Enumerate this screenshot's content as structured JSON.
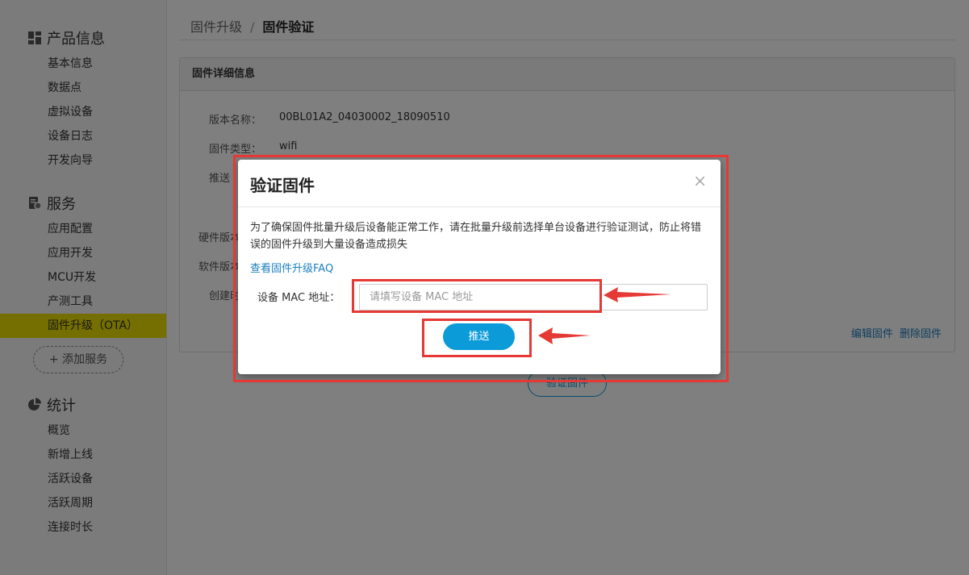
{
  "sidebar": {
    "groups": [
      {
        "title": "产品信息",
        "icon": "dashboard-icon",
        "items": [
          "基本信息",
          "数据点",
          "虚拟设备",
          "设备日志",
          "开发向导"
        ]
      },
      {
        "title": "服务",
        "icon": "service-icon",
        "items": [
          "应用配置",
          "应用开发",
          "MCU开发",
          "产测工具",
          "固件升级（OTA）"
        ]
      },
      {
        "title": "统计",
        "icon": "pie-chart-icon",
        "items": [
          "概览",
          "新增上线",
          "活跃设备",
          "活跃周期",
          "连接时长"
        ]
      }
    ],
    "add_service": "+ 添加服务",
    "active_item": "固件升级（OTA）",
    "active_color": "#e8de00"
  },
  "breadcrumb": {
    "parent": "固件升级",
    "separator": "/",
    "current": "固件验证"
  },
  "panel": {
    "title": "固件详细信息",
    "fields": [
      {
        "label": "版本名称：",
        "value": "00BL01A2_04030002_18090510"
      },
      {
        "label": "固件类型：",
        "value": "wifi"
      },
      {
        "label": "推送",
        "value": ""
      },
      {
        "label": "硬件版本",
        "value": ""
      },
      {
        "label": "软件版本",
        "value": ""
      },
      {
        "label": "创建时",
        "value": ""
      }
    ],
    "links": {
      "edit": "编辑固件",
      "delete": "删除固件"
    },
    "verify_button": "验证固件"
  },
  "modal": {
    "title": "验证固件",
    "close": "×",
    "description": "为了确保固件批量升级后设备能正常工作，请在批量升级前选择单台设备进行验证测试，防止将错误的固件升级到大量设备造成损失",
    "faq_link": "查看固件升级FAQ",
    "mac_label": "设备 MAC 地址：",
    "mac_placeholder": "请填写设备 MAC 地址",
    "mac_value": "",
    "push_button": "推送",
    "accent_color": "#0a9bd8"
  },
  "annotations": {
    "highlight_color": "#e53935"
  }
}
